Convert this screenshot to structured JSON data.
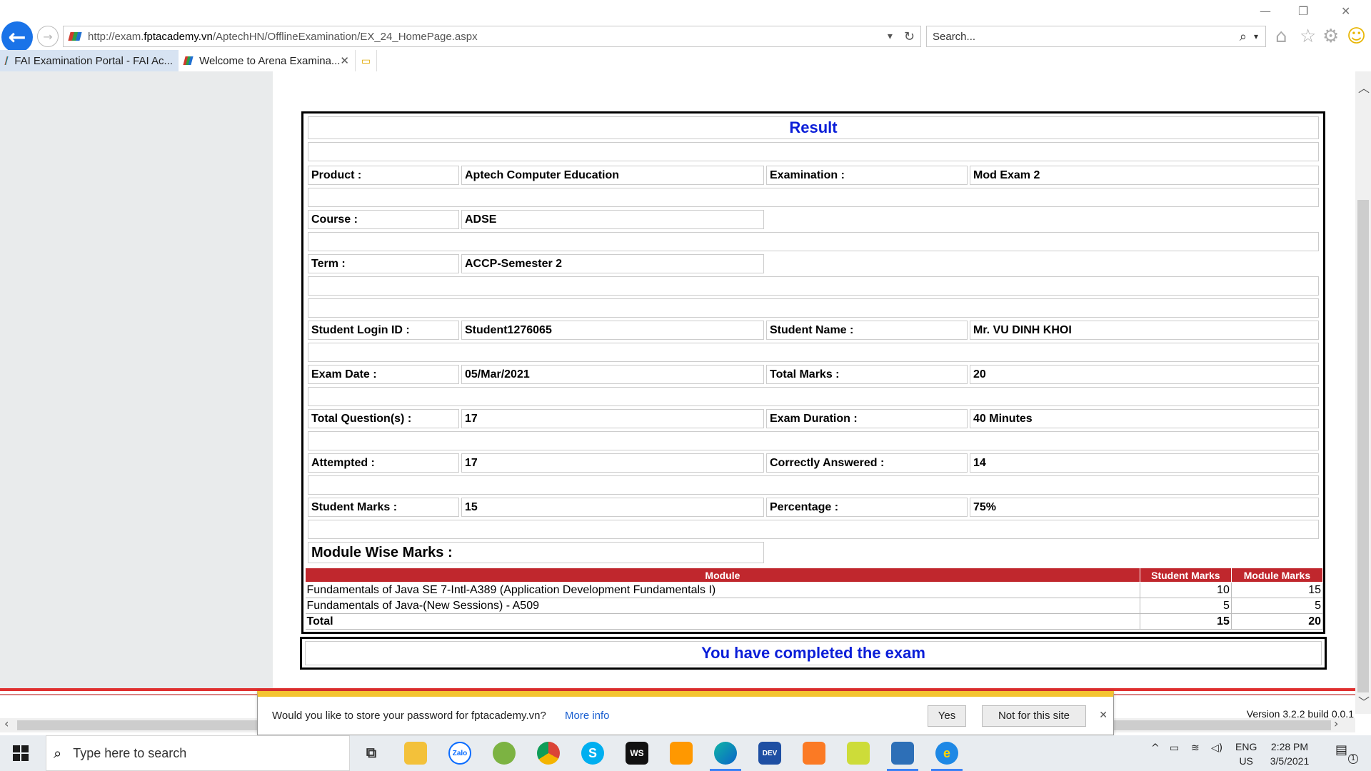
{
  "browser": {
    "url": "http://exam.fptacademy.vn/AptechHN/OfflineExamination/EX_24_HomePage.aspx",
    "url_host_part": "fptacademy.vn",
    "search_placeholder": "Search...",
    "tabs": [
      {
        "label": "FAI Examination Portal - FAI Ac...",
        "active": false
      },
      {
        "label": "Welcome to Arena Examina...",
        "active": true
      }
    ]
  },
  "result": {
    "title": "Result",
    "fields": {
      "product_label": "Product :",
      "product_value": "Aptech Computer Education",
      "exam_label": "Examination :",
      "exam_value": "Mod Exam 2",
      "course_label": "Course :",
      "course_value": "ADSE",
      "term_label": "Term :",
      "term_value": "ACCP-Semester 2",
      "login_label": "Student Login ID :",
      "login_value": "Student1276065",
      "name_label": "Student Name :",
      "name_value": "Mr. VU DINH KHOI",
      "date_label": "Exam Date :",
      "date_value": "05/Mar/2021",
      "total_marks_label": "Total Marks :",
      "total_marks_value": "20",
      "questions_label": "Total Question(s) :",
      "questions_value": "17",
      "duration_label": "Exam Duration :",
      "duration_value": "40 Minutes",
      "attempted_label": "Attempted :",
      "attempted_value": "17",
      "correct_label": "Correctly Answered :",
      "correct_value": "14",
      "student_marks_label": "Student Marks :",
      "student_marks_value": "15",
      "percentage_label": "Percentage :",
      "percentage_value": "75%"
    },
    "module_wise_label": "Module Wise Marks :",
    "module_table": {
      "headers": [
        "Module",
        "Student Marks",
        "Module Marks"
      ],
      "rows": [
        [
          "Fundamentals of Java SE 7-Intl-A389 (Application Development Fundamentals I)",
          "10",
          "15"
        ],
        [
          "Fundamentals of Java-(New Sessions) - A509",
          "5",
          "5"
        ]
      ],
      "total": [
        "Total",
        "15",
        "20"
      ]
    },
    "completed_message": "You have completed the exam"
  },
  "footer": {
    "version": "Version 3.2.2 build 0.0.1"
  },
  "notification": {
    "message": "Would you like to store your password for fptacademy.vn?",
    "more_info": "More info",
    "yes": "Yes",
    "not_for_site": "Not for this site"
  },
  "taskbar": {
    "search_placeholder": "Type here to search",
    "apps": [
      "task-view",
      "file-explorer",
      "zalo",
      "coccoc",
      "chrome",
      "skype",
      "webstorm",
      "sublime-text",
      "edge",
      "dev-cpp",
      "xampp",
      "codeblocks",
      "virtualbox",
      "internet-explorer"
    ],
    "zalo_label": "Zalo",
    "webstorm_label": "WS",
    "devcpp_label": "DEV",
    "skype_label": "S",
    "lang_line1": "ENG",
    "lang_line2": "US",
    "time": "2:28 PM",
    "date": "3/5/2021",
    "notification_count": "1"
  },
  "colors": {
    "accent_blue": "#0a1ed8",
    "table_header_red": "#c0272d",
    "footer_red": "#e03030",
    "notify_yellow": "#f4c430"
  }
}
